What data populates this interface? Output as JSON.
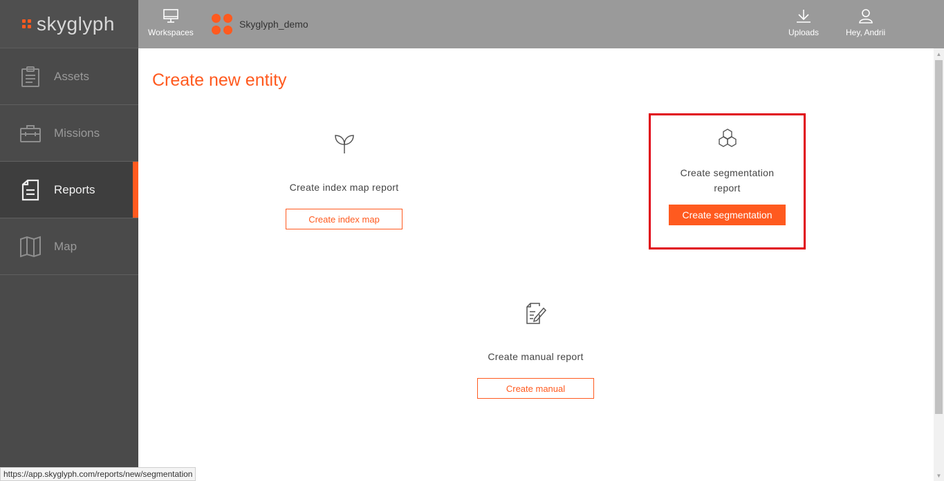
{
  "brand": {
    "logo_text": "skyglyph",
    "accent": "#ff5a1f"
  },
  "topbar": {
    "workspaces_label": "Workspaces",
    "project_name": "Skyglyph_demo",
    "uploads_label": "Uploads",
    "user_label": "Hey, Andrii"
  },
  "sidebar": {
    "items": [
      {
        "label": "Assets",
        "icon": "clipboard-icon",
        "active": false
      },
      {
        "label": "Missions",
        "icon": "briefcase-icon",
        "active": false
      },
      {
        "label": "Reports",
        "icon": "document-icon",
        "active": true
      },
      {
        "label": "Map",
        "icon": "map-icon",
        "active": false
      }
    ]
  },
  "main": {
    "title": "Create new entity",
    "cards": {
      "index": {
        "label": "Create index map report",
        "button": "Create index map",
        "icon": "sprout-icon"
      },
      "segmentation": {
        "label": "Create segmentation report",
        "button": "Create segmentation",
        "icon": "hexagons-icon"
      },
      "manual": {
        "label": "Create manual report",
        "button": "Create manual",
        "icon": "edit-document-icon"
      }
    }
  },
  "status_url": "https://app.skyglyph.com/reports/new/segmentation"
}
